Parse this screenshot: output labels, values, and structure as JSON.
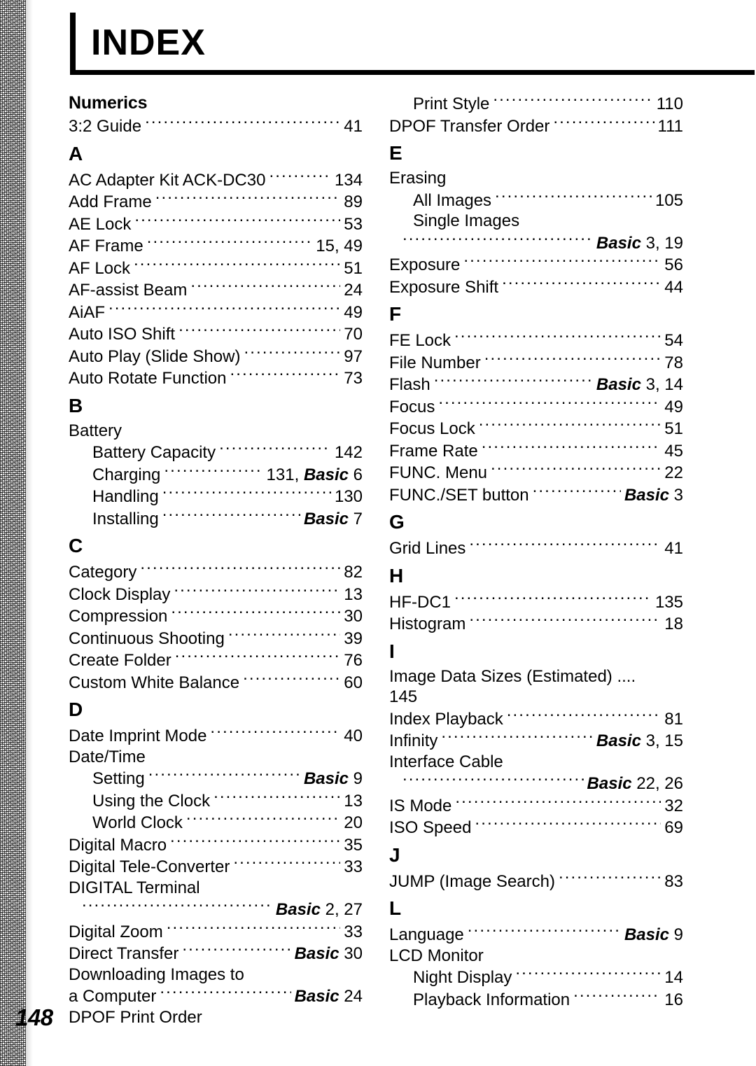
{
  "document": {
    "title": "INDEX",
    "page_number": "148"
  },
  "columns": [
    {
      "id": "left",
      "sections": [
        {
          "letter": "Numerics",
          "style": "numerics",
          "entries": [
            {
              "type": "leader",
              "label": "3:2 Guide",
              "page": "41"
            }
          ]
        },
        {
          "letter": "A",
          "entries": [
            {
              "type": "leader",
              "label": "AC Adapter Kit ACK-DC30",
              "page": "134"
            },
            {
              "type": "leader",
              "label": "Add Frame",
              "page": "89"
            },
            {
              "type": "leader",
              "label": "AE Lock",
              "page": "53"
            },
            {
              "type": "leader",
              "label": "AF Frame",
              "page": "15,  49"
            },
            {
              "type": "leader",
              "label": "AF Lock",
              "page": "51"
            },
            {
              "type": "leader",
              "label": "AF-assist Beam",
              "page": "24"
            },
            {
              "type": "leader",
              "label": "AiAF",
              "page": "49"
            },
            {
              "type": "leader",
              "label": "Auto ISO Shift",
              "page": "70"
            },
            {
              "type": "leader",
              "label": "Auto Play (Slide Show)",
              "page": "97"
            },
            {
              "type": "leader",
              "label": "Auto Rotate Function",
              "page": "73"
            }
          ]
        },
        {
          "letter": "B",
          "entries": [
            {
              "type": "plain",
              "label": "Battery"
            },
            {
              "type": "leader",
              "indent": 1,
              "label": "Battery Capacity",
              "page": "142"
            },
            {
              "type": "leader",
              "indent": 1,
              "label": "Charging",
              "page_prefix": "131, ",
              "page_italic": "Basic",
              "page_suffix": " 6"
            },
            {
              "type": "leader",
              "indent": 1,
              "label": "Handling",
              "page": "130"
            },
            {
              "type": "leader",
              "indent": 1,
              "label": "Installing",
              "page_italic": "Basic",
              "page_suffix": " 7"
            }
          ]
        },
        {
          "letter": "C",
          "entries": [
            {
              "type": "leader",
              "label": "Category",
              "page": "82"
            },
            {
              "type": "leader",
              "label": "Clock Display",
              "page": "13"
            },
            {
              "type": "leader",
              "label": "Compression",
              "page": "30"
            },
            {
              "type": "leader",
              "label": "Continuous Shooting",
              "page": "39"
            },
            {
              "type": "leader",
              "label": "Create Folder",
              "page": "76"
            },
            {
              "type": "leader",
              "label": "Custom White Balance",
              "page": "60"
            }
          ]
        },
        {
          "letter": "D",
          "entries": [
            {
              "type": "leader",
              "label": "Date Imprint Mode",
              "page": "40"
            },
            {
              "type": "plain",
              "label": "Date/Time"
            },
            {
              "type": "leader",
              "indent": 1,
              "label": "Setting",
              "page_italic": "Basic",
              "page_suffix": " 9"
            },
            {
              "type": "leader",
              "indent": 1,
              "label": "Using the Clock",
              "page": "13"
            },
            {
              "type": "leader",
              "indent": 1,
              "label": "World Clock",
              "page": "20"
            },
            {
              "type": "leader",
              "label": "Digital Macro",
              "page": "35"
            },
            {
              "type": "leader",
              "label": "Digital Tele-Converter",
              "page": "33"
            },
            {
              "type": "plain",
              "label": "DIGITAL Terminal"
            },
            {
              "type": "leader",
              "cont": true,
              "label": "",
              "page_italic": "Basic",
              "page_suffix": " 2, 27"
            },
            {
              "type": "leader",
              "label": "Digital Zoom",
              "page": "33"
            },
            {
              "type": "leader",
              "label": "Direct Transfer",
              "page_italic": "Basic",
              "page_suffix": " 30"
            },
            {
              "type": "plain",
              "label": "Downloading Images to"
            },
            {
              "type": "leader",
              "label": "a Computer",
              "page_italic": "Basic",
              "page_suffix": " 24"
            },
            {
              "type": "plain",
              "label": "DPOF Print Order"
            }
          ]
        }
      ]
    },
    {
      "id": "right",
      "sections": [
        {
          "letter": "",
          "entries": [
            {
              "type": "leader",
              "indent": 1,
              "label": "Print Style",
              "page": "110"
            },
            {
              "type": "leader",
              "label": "DPOF Transfer Order",
              "page": "111"
            }
          ]
        },
        {
          "letter": "E",
          "entries": [
            {
              "type": "plain",
              "label": "Erasing"
            },
            {
              "type": "leader",
              "indent": 1,
              "label": "All Images",
              "page": "105"
            },
            {
              "type": "plain",
              "indent": 1,
              "label": "Single Images"
            },
            {
              "type": "leader",
              "cont": true,
              "label": "",
              "page_italic": "Basic",
              "page_suffix": " 3, 19"
            },
            {
              "type": "leader",
              "label": "Exposure",
              "page": "56"
            },
            {
              "type": "leader",
              "label": "Exposure Shift",
              "page": "44"
            }
          ]
        },
        {
          "letter": "F",
          "entries": [
            {
              "type": "leader",
              "label": "FE Lock",
              "page": "54"
            },
            {
              "type": "leader",
              "label": "File Number",
              "page": "78"
            },
            {
              "type": "leader",
              "label": "Flash",
              "page_italic": "Basic",
              "page_suffix": " 3, 14"
            },
            {
              "type": "leader",
              "label": "Focus",
              "page": "49"
            },
            {
              "type": "leader",
              "label": "Focus Lock",
              "page": "51"
            },
            {
              "type": "leader",
              "label": "Frame Rate",
              "page": "45"
            },
            {
              "type": "leader",
              "label": "FUNC. Menu",
              "page": "22"
            },
            {
              "type": "leader",
              "label": "FUNC./SET button",
              "page_italic": "Basic",
              "page_suffix": " 3"
            }
          ]
        },
        {
          "letter": "G",
          "entries": [
            {
              "type": "leader",
              "label": "Grid Lines",
              "page": "41"
            }
          ]
        },
        {
          "letter": "H",
          "entries": [
            {
              "type": "leader",
              "label": "HF-DC1",
              "page": "135"
            },
            {
              "type": "leader",
              "label": "Histogram",
              "page": "18"
            }
          ]
        },
        {
          "letter": "I",
          "entries": [
            {
              "type": "wrap",
              "label": "Image Data Sizes (Estimated) ....",
              "wrap_page": "145"
            },
            {
              "type": "leader",
              "label": "Index Playback",
              "page": "81"
            },
            {
              "type": "leader",
              "label": "Infinity",
              "page_italic": "Basic",
              "page_suffix": " 3, 15"
            },
            {
              "type": "plain",
              "label": "Interface Cable"
            },
            {
              "type": "leader",
              "cont": true,
              "label": "",
              "page_italic": "Basic",
              "page_suffix": " 22, 26"
            },
            {
              "type": "leader",
              "label": "IS Mode",
              "page": "32"
            },
            {
              "type": "leader",
              "label": "ISO Speed",
              "page": "69"
            }
          ]
        },
        {
          "letter": "J",
          "entries": [
            {
              "type": "leader",
              "label": "JUMP (Image Search)",
              "page": "83"
            }
          ]
        },
        {
          "letter": "L",
          "entries": [
            {
              "type": "leader",
              "label": "Language",
              "page_italic": "Basic",
              "page_suffix": " 9"
            },
            {
              "type": "plain",
              "label": "LCD Monitor"
            },
            {
              "type": "leader",
              "indent": 1,
              "label": "Night Display",
              "page": "14"
            },
            {
              "type": "leader",
              "indent": 1,
              "label": "Playback Information",
              "page": "16"
            }
          ]
        }
      ]
    }
  ]
}
